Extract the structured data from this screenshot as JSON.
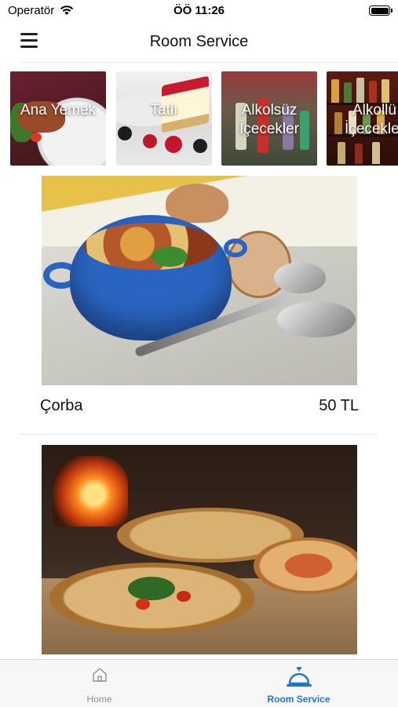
{
  "status_bar": {
    "carrier": "Operatör",
    "time": "ÖÖ 11:26"
  },
  "navbar": {
    "title": "Room Service"
  },
  "categories": [
    {
      "label": "Ana Yemek"
    },
    {
      "label": "Tatlı"
    },
    {
      "label": "Alkolsüz İçecekler"
    },
    {
      "label": "Alkollü İçecekler"
    }
  ],
  "items": [
    {
      "name": "Çorba",
      "price": "50 TL"
    }
  ],
  "tabbar": {
    "tabs": [
      {
        "label": "Home",
        "selected": false
      },
      {
        "label": "Room Service",
        "selected": true
      }
    ]
  },
  "colors": {
    "accent": "#1f74d6",
    "tab_inactive": "#8e8e93"
  }
}
